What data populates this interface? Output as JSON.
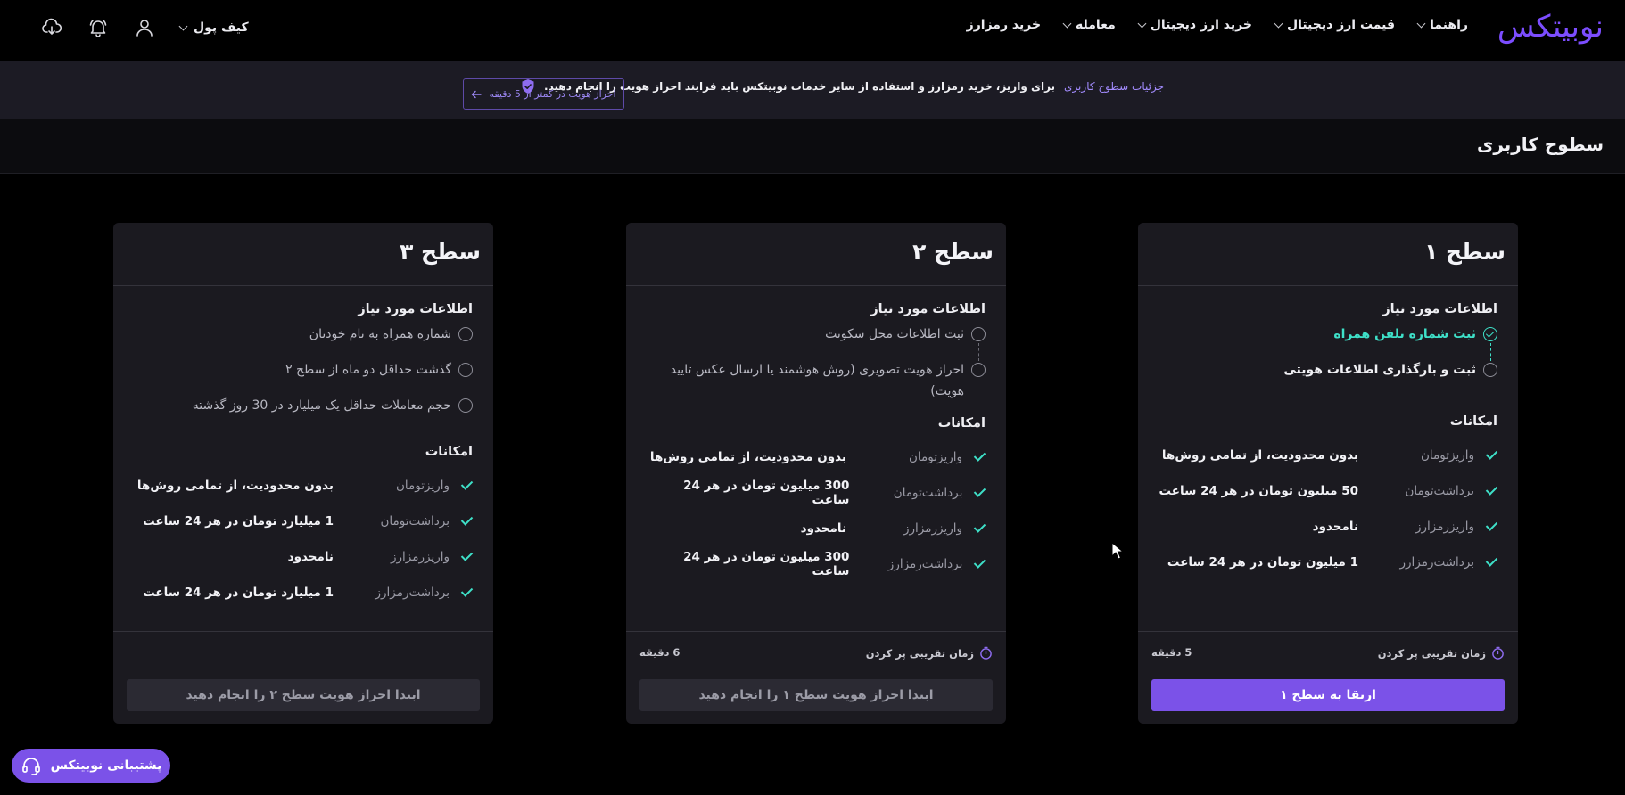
{
  "header": {
    "logo": "نوبیتکس",
    "nav": [
      {
        "label": "خرید رمزارز",
        "dropdown": false
      },
      {
        "label": "معامله",
        "dropdown": true
      },
      {
        "label": "خرید ارز دیجیتال",
        "dropdown": true
      },
      {
        "label": "قیمت ارز دیجیتال",
        "dropdown": true
      },
      {
        "label": "راهنما",
        "dropdown": true
      }
    ],
    "wallet_label": "کیف پول",
    "icons": [
      "download-app-icon",
      "notification-bell-icon",
      "user-icon"
    ]
  },
  "banner": {
    "text": "برای واریز، خرید رمزارز و استفاده از سایر خدمات نوبیتکس باید فرایند احراز هویت را انجام دهید.",
    "link": "جزئیات سطوح کاربری",
    "button": "احراز هویت در کمتر از 5 دقیقه"
  },
  "section_title": "سطوح کاربری",
  "cards": [
    {
      "title": "سطح ۱",
      "requirements_title": "اطلاعات مورد نیاز",
      "requirements": [
        {
          "label": "ثبت شماره تلفن همراه",
          "status": "done"
        },
        {
          "label": "ثبت و بارگذاری اطلاعات هویتی",
          "status": "pending"
        }
      ],
      "features_title": "امکانات",
      "features": [
        {
          "name": "واریزتومان",
          "value": "بدون محدودیت، از تمامی روش‌ها"
        },
        {
          "name": "برداشت‌تومان",
          "value": "50 میلیون تومان در هر 24 ساعت"
        },
        {
          "name": "واریزرمزارز",
          "value": "نامحدود"
        },
        {
          "name": "برداشت‌رمزارز",
          "value": "1 میلیون تومان در هر 24 ساعت"
        }
      ],
      "time_label": "زمان تقریبی پر کردن",
      "time_value": "5 دقیقه",
      "button": "ارتقا به سطح ۱",
      "button_primary": true
    },
    {
      "title": "سطح ۲",
      "requirements_title": "اطلاعات مورد نیاز",
      "requirements": [
        {
          "label": "ثبت اطلاعات محل سکونت",
          "status": "pending"
        },
        {
          "label": "احراز هویت تصویری (روش هوشمند یا ارسال عکس تایید هویت)",
          "status": "pending"
        }
      ],
      "features_title": "امکانات",
      "features": [
        {
          "name": "واریزتومان",
          "value": "بدون محدودیت، از تمامی روش‌ها"
        },
        {
          "name": "برداشت‌تومان",
          "value": "300 میلیون تومان در هر 24 ساعت"
        },
        {
          "name": "واریزرمزارز",
          "value": "نامحدود"
        },
        {
          "name": "برداشت‌رمزارز",
          "value": "300 میلیون تومان در هر 24 ساعت"
        }
      ],
      "time_label": "زمان تقریبی پر کردن",
      "time_value": "6 دقیقه",
      "button": "ابتدا احراز هویت سطح ۱ را انجام دهید",
      "button_primary": false
    },
    {
      "title": "سطح ۳",
      "requirements_title": "اطلاعات مورد نیاز",
      "requirements": [
        {
          "label": "شماره همراه به نام خودتان",
          "status": "pending"
        },
        {
          "label": "گذشت حداقل دو ماه از سطح ۲",
          "status": "pending"
        },
        {
          "label": "حجم معاملات حداقل یک میلیارد در 30 روز گذشته",
          "status": "pending"
        }
      ],
      "features_title": "امکانات",
      "features": [
        {
          "name": "واریزتومان",
          "value": "بدون محدودیت، از تمامی روش‌ها"
        },
        {
          "name": "برداشت‌تومان",
          "value": "1 میلیارد تومان در هر 24 ساعت"
        },
        {
          "name": "واریزرمزارز",
          "value": "نامحدود"
        },
        {
          "name": "برداشت‌رمزارز",
          "value": "1 میلیارد تومان در هر 24 ساعت"
        }
      ],
      "button": "ابتدا احراز هویت سطح ۲ را انجام دهید",
      "button_primary": false
    }
  ],
  "support": {
    "label": "پشتیبانی نوبیتکس"
  },
  "colors": {
    "accent": "#7b52e8",
    "success": "#3ee0c8",
    "card_bg": "#1b1a20",
    "banner_bg": "#1c1b24"
  }
}
